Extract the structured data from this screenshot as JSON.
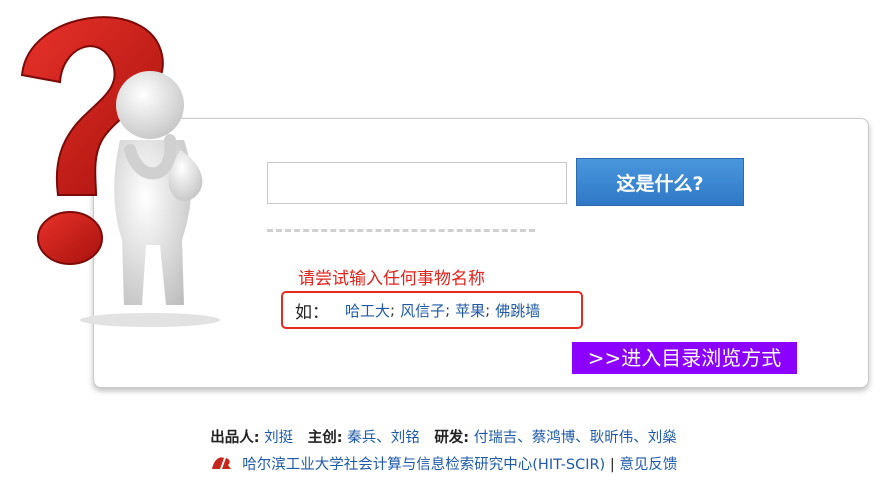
{
  "search": {
    "value": "",
    "placeholder": "",
    "button_label": "这是什么?"
  },
  "hint": "请尝试输入任何事物名称",
  "examples": {
    "prefix": "如：",
    "items": [
      "哈工大",
      "风信子",
      "苹果",
      "佛跳墙"
    ],
    "separator": ";"
  },
  "browse_label": ">>进入目录浏览方式",
  "footer": {
    "producer_label": "出品人:",
    "producer": "刘挺",
    "lead_label": "主创:",
    "leads": "秦兵、刘铭",
    "dev_label": "研发:",
    "devs": "付瑞吉、蔡鸿博、耿昕伟、刘燊",
    "org": "哈尔滨工业大学社会计算与信息检索研究中心(HIT-SCIR)",
    "divider": "|",
    "feedback": "意见反馈"
  },
  "colors": {
    "accent_blue": "#2f78c6",
    "hint_red": "#e0231b",
    "browse_purple": "#8c00ff",
    "link_blue": "#1e5aa8"
  },
  "icons": {
    "figure": "question-mark-thinker-icon",
    "logo": "hit-scir-logo-icon"
  }
}
